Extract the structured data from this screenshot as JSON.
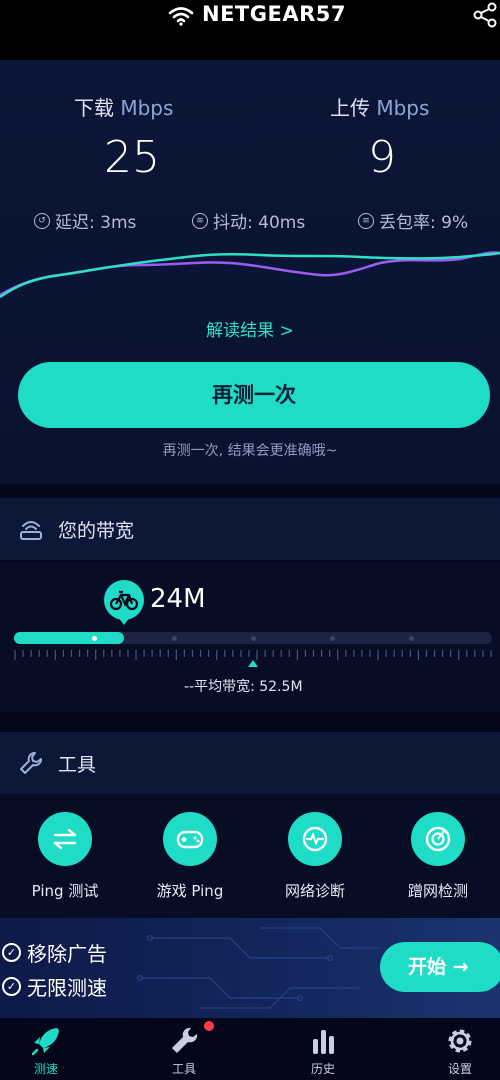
{
  "header": {
    "network_name": "NETGEAR57"
  },
  "result": {
    "download_label": "下载",
    "download_unit": "Mbps",
    "download_value": "25",
    "upload_label": "上传",
    "upload_unit": "Mbps",
    "upload_value": "9",
    "latency": "延迟: 3ms",
    "jitter": "抖动: 40ms",
    "packet_loss": "丢包率: 9%",
    "interpret_link": "解读结果 >",
    "retest_button": "再测一次",
    "hint": "再测一次, 结果会更准确哦~"
  },
  "bandwidth": {
    "title": "您的带宽",
    "value": "24M",
    "level_fraction": 0.23,
    "average_label": "--平均带宽: 52.5M"
  },
  "tools": {
    "title": "工具",
    "items": [
      {
        "label": "Ping 测试",
        "icon": "swap-arrows-icon"
      },
      {
        "label": "游戏 Ping",
        "icon": "gamepad-icon"
      },
      {
        "label": "网络诊断",
        "icon": "pulse-icon"
      },
      {
        "label": "蹭网检测",
        "icon": "radar-icon"
      }
    ]
  },
  "promo": {
    "item1": "移除广告",
    "item2": "无限测速",
    "start_button": "开始 →"
  },
  "tabbar": {
    "tabs": [
      {
        "label": "测速",
        "active": true
      },
      {
        "label": "工具",
        "badge": true
      },
      {
        "label": "历史"
      },
      {
        "label": "设置"
      }
    ]
  },
  "colors": {
    "accent": "#1fdcc6",
    "background": "#05081a",
    "upload_line": "#9b5cf0",
    "badge": "#ff3b4a"
  }
}
